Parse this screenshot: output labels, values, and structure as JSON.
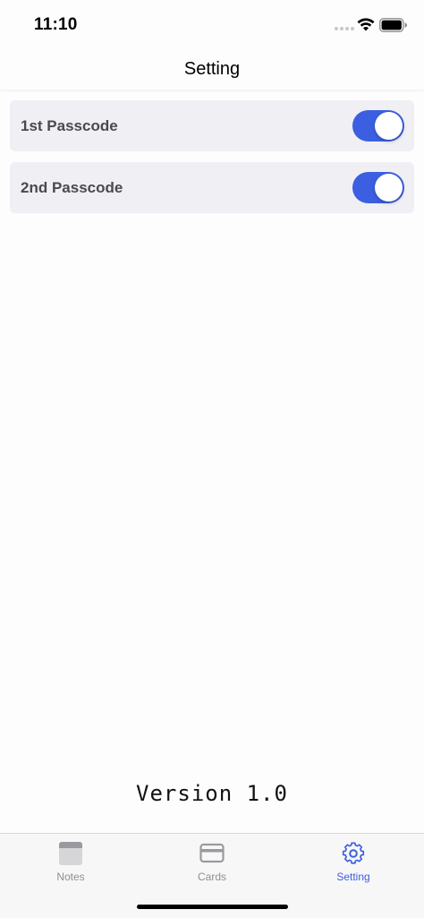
{
  "status_bar": {
    "time": "11:10",
    "icons": [
      "signal-dots-icon",
      "wifi-icon",
      "battery-icon"
    ]
  },
  "nav": {
    "title": "Setting"
  },
  "settings": {
    "items": [
      {
        "label": "1st Passcode",
        "enabled": true
      },
      {
        "label": "2nd Passcode",
        "enabled": true
      }
    ],
    "toggle_on_color": "#3b5fe0"
  },
  "footer": {
    "version": "Version 1.0"
  },
  "tab_bar": {
    "active_color": "#3b5fe0",
    "inactive_color": "#8e8e93",
    "tabs": [
      {
        "label": "Notes",
        "icon": "notes-icon",
        "active": false
      },
      {
        "label": "Cards",
        "icon": "card-icon",
        "active": false
      },
      {
        "label": "Setting",
        "icon": "gear-icon",
        "active": true
      }
    ]
  }
}
